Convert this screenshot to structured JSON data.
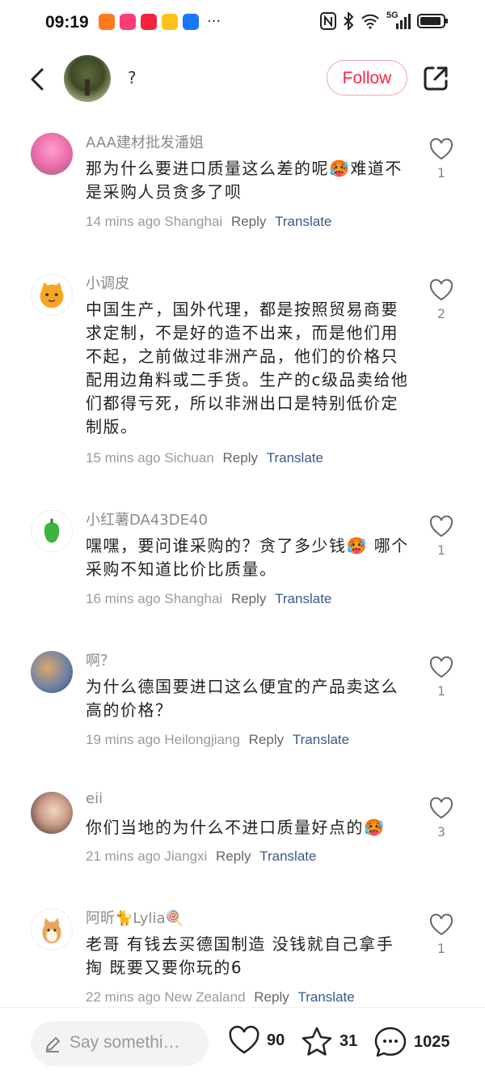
{
  "status_bar": {
    "time": "09:19",
    "network": "5G",
    "app_icons": [
      "taobao-icon",
      "app-pink-icon",
      "app-red-icon",
      "app-yellow-icon",
      "alipay-icon"
    ]
  },
  "header": {
    "title": "?",
    "follow_label": "Follow"
  },
  "colors": {
    "accent": "#ff2442",
    "translate_link": "#3a5a8c"
  },
  "comments": [
    {
      "user": "AAA建材批发潘姐",
      "text": "那为什么要进口质量这么差的呢🥵难道不是采购人员贪多了呗",
      "time": "14 mins ago",
      "location": "Shanghai",
      "reply": "Reply",
      "translate": "Translate",
      "likes": "1"
    },
    {
      "user": "小调皮",
      "text": "中国生产，国外代理，都是按照贸易商要求定制，不是好的造不出来，而是他们用不起，之前做过非洲产品，他们的价格只配用边角料或二手货。生产的c级品卖给他们都得亏死，所以非洲出口是特别低价定制版。",
      "time": "15 mins ago",
      "location": "Sichuan",
      "reply": "Reply",
      "translate": "Translate",
      "likes": "2"
    },
    {
      "user": "小红薯DA43DE40",
      "text": "嘿嘿，要问谁采购的？贪了多少钱🥵 哪个采购不知道比价比质量。",
      "time": "16 mins ago",
      "location": "Shanghai",
      "reply": "Reply",
      "translate": "Translate",
      "likes": "1"
    },
    {
      "user": "啊？",
      "text": "为什么德国要进口这么便宜的产品卖这么高的价格？",
      "time": "19 mins ago",
      "location": "Heilongjiang",
      "reply": "Reply",
      "translate": "Translate",
      "likes": "1"
    },
    {
      "user": "eii",
      "text": "你们当地的为什么不进口质量好点的🥵",
      "time": "21 mins ago",
      "location": "Jiangxi",
      "reply": "Reply",
      "translate": "Translate",
      "likes": "3"
    },
    {
      "user": "阿昕🐈Lylia🍭",
      "text": "老哥 有钱去买德国制造 没钱就自己拿手掏 既要又要你玩的6",
      "time": "22 mins ago",
      "location": "New Zealand",
      "reply": "Reply",
      "translate": "Translate",
      "likes": "1"
    }
  ],
  "bottom_bar": {
    "input_placeholder": "Say somethi…",
    "likes": "90",
    "favorites": "31",
    "comments": "1025"
  }
}
